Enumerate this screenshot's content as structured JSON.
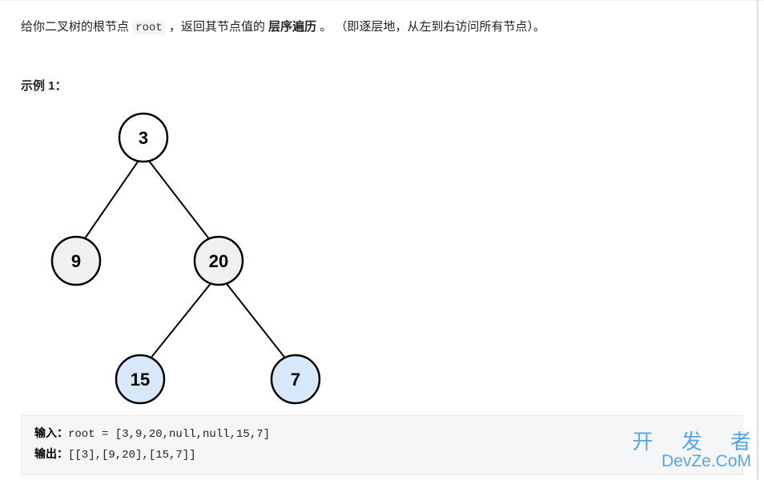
{
  "problem": {
    "desc_pre": "给你二叉树的根节点 ",
    "desc_code": "root",
    "desc_mid": " ，返回其节点值的 ",
    "desc_bold": "层序遍历",
    "desc_post": " 。 （即逐层地，从左到右访问所有节点）。"
  },
  "example": {
    "heading": "示例 1：",
    "input_label": "输入：",
    "input_code": "root = [3,9,20,null,null,15,7]",
    "output_label": "输出：",
    "output_code": "[[3],[9,20],[15,7]]"
  },
  "tree": {
    "node_root": "3",
    "node_left": "9",
    "node_right": "20",
    "node_left_leaf": "15",
    "node_right_leaf": "7"
  },
  "watermark": {
    "top": "开 发 者",
    "bottom": "DevZe.CoM"
  }
}
